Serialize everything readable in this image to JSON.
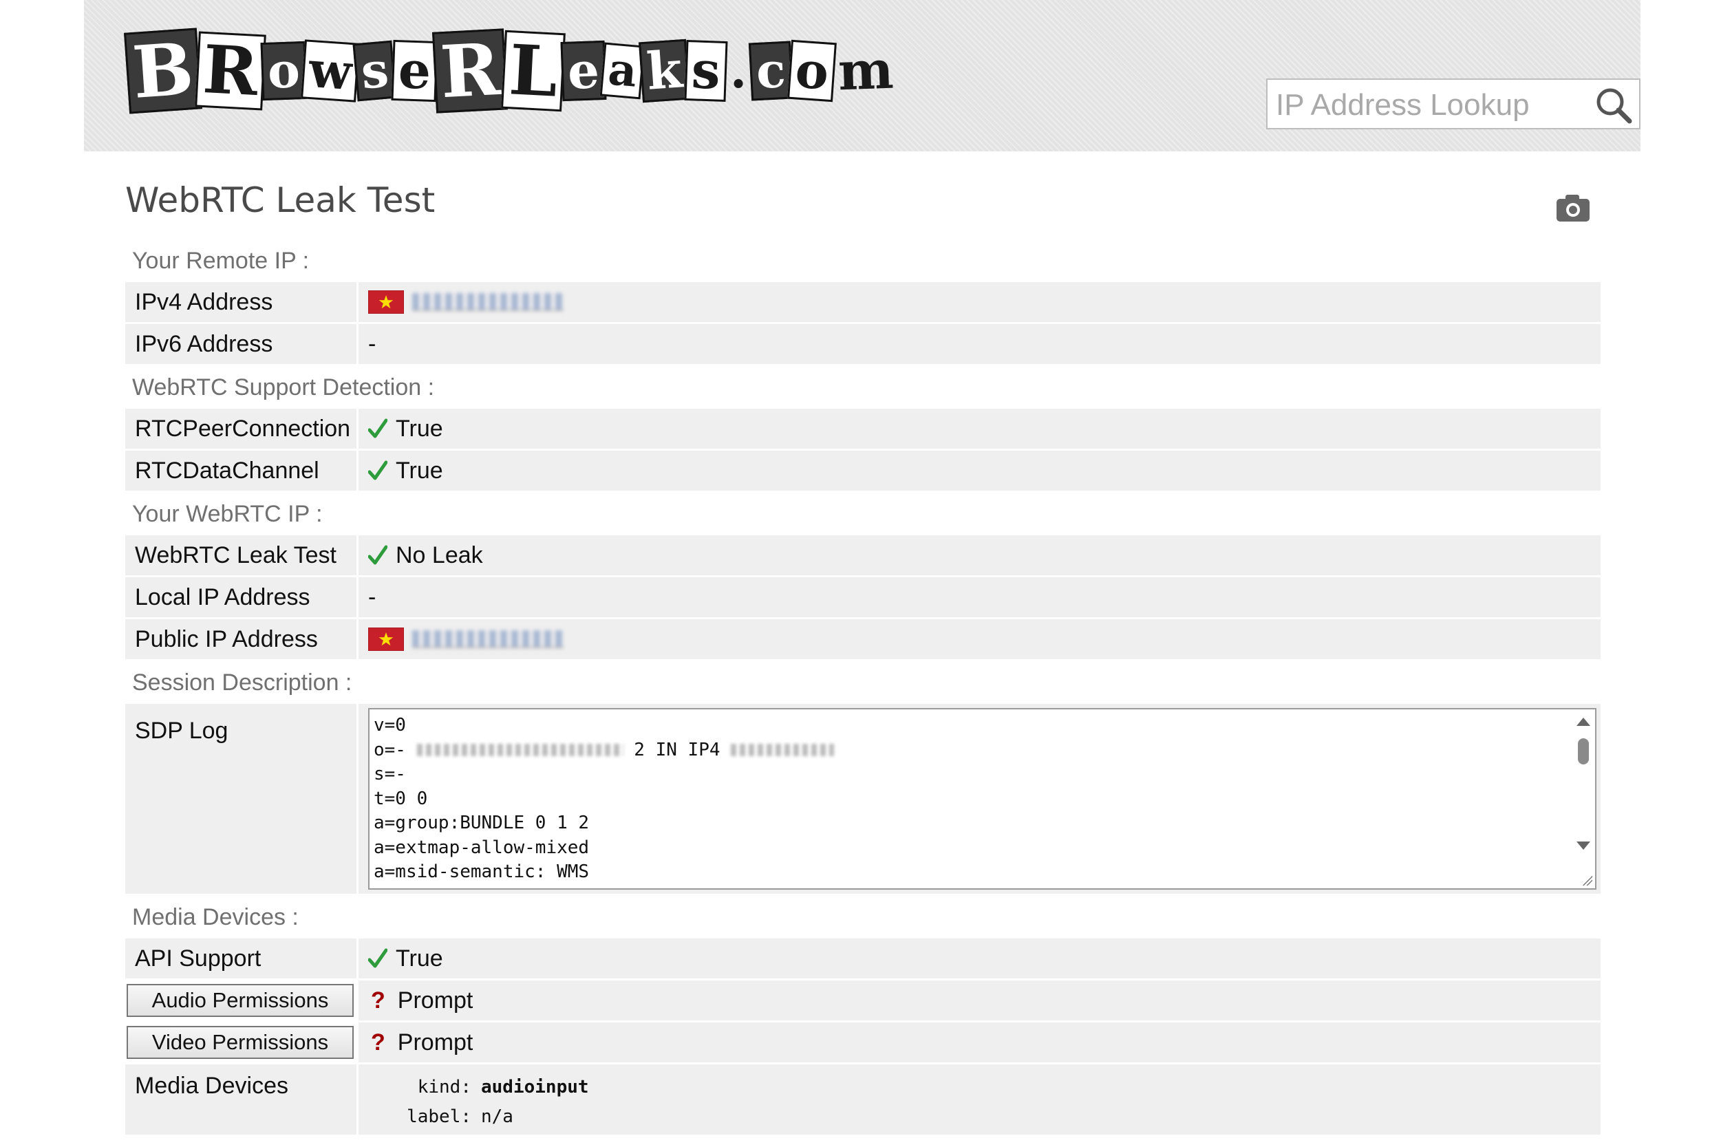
{
  "header": {
    "logo_text": "BRowseRLeaks.com",
    "search_placeholder": "IP Address Lookup"
  },
  "page": {
    "title": "WebRTC Leak Test"
  },
  "sections": {
    "remote_ip": {
      "label": "Your Remote IP :",
      "ipv4_label": "IPv4 Address",
      "ipv6_label": "IPv6 Address",
      "ipv6_value": "-"
    },
    "support": {
      "label": "WebRTC Support Detection :",
      "peer_label": "RTCPeerConnection",
      "peer_value": "True",
      "channel_label": "RTCDataChannel",
      "channel_value": "True"
    },
    "webrtc_ip": {
      "label": "Your WebRTC IP :",
      "leak_label": "WebRTC Leak Test",
      "leak_value": "No Leak",
      "local_label": "Local IP Address",
      "local_value": "-",
      "public_label": "Public IP Address"
    },
    "session": {
      "label": "Session Description :",
      "sdp_label": "SDP Log",
      "sdp_lines": [
        "v=0",
        "o=-",
        "s=-",
        "t=0 0",
        "a=group:BUNDLE 0 1 2",
        "a=extmap-allow-mixed",
        "a=msid-semantic: WMS"
      ],
      "sdp_line2_mid": "2 IN IP4"
    },
    "media": {
      "label": "Media Devices :",
      "api_label": "API Support",
      "api_value": "True",
      "audio_button": "Audio Permissions",
      "audio_value": "Prompt",
      "video_button": "Video Permissions",
      "video_value": "Prompt",
      "devices_label": "Media Devices",
      "kind_key": "kind:",
      "kind_value": "audioinput",
      "label_key": "label:",
      "label_value": "n/a"
    }
  },
  "colors": {
    "check_green": "#2e9b3c",
    "question_red": "#a00000",
    "row_bg": "#efefef",
    "flag_red": "#c8202a",
    "flag_star": "#ffde00"
  },
  "icons": {
    "search": "search-icon",
    "camera": "camera-icon",
    "check": "check-icon",
    "question": "question-icon",
    "flag": "vietnam-flag-icon"
  }
}
